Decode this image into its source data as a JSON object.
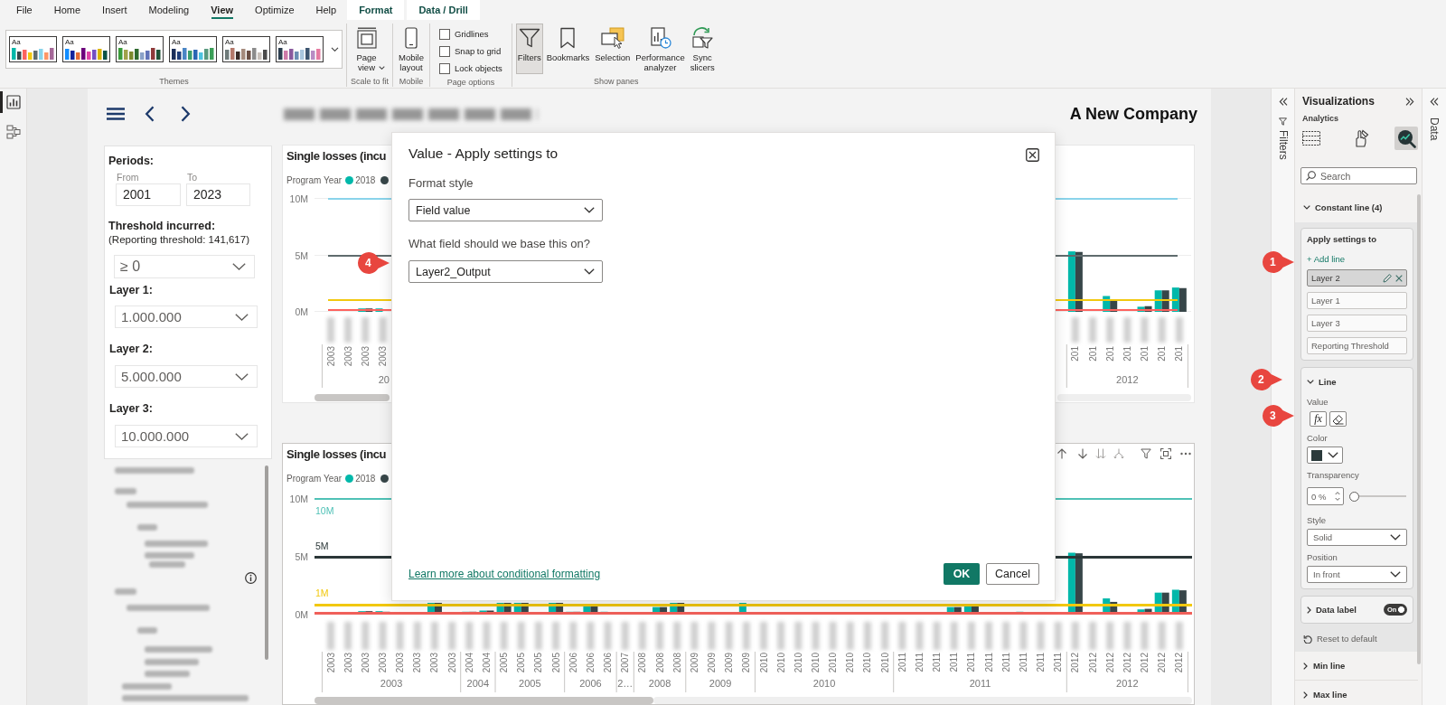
{
  "menu_tabs": [
    {
      "label": "File",
      "kind": "standard",
      "selected": false
    },
    {
      "label": "Home",
      "kind": "standard",
      "selected": false
    },
    {
      "label": "Insert",
      "kind": "standard",
      "selected": false
    },
    {
      "label": "Modeling",
      "kind": "standard",
      "selected": false
    },
    {
      "label": "View",
      "kind": "standard",
      "selected": true
    },
    {
      "label": "Optimize",
      "kind": "standard",
      "selected": false
    },
    {
      "label": "Help",
      "kind": "standard",
      "selected": false
    },
    {
      "label": "Format",
      "kind": "contextual",
      "selected": false
    },
    {
      "label": "Data / Drill",
      "kind": "contextual",
      "selected": false
    }
  ],
  "ribbon": {
    "themes": {
      "swatches": [
        {
          "label": "Aa"
        },
        {
          "label": "Aa"
        },
        {
          "label": "Aa"
        },
        {
          "label": "Aa"
        },
        {
          "label": "Aa"
        },
        {
          "label": "Aa"
        }
      ],
      "group_label": "Themes"
    },
    "scale_to_fit": {
      "button": "Page view",
      "group_label": "Scale to fit"
    },
    "mobile": {
      "button": "Mobile layout",
      "group_label": "Mobile"
    },
    "page_options": {
      "checkboxes": [
        {
          "label": "Gridlines",
          "checked": false
        },
        {
          "label": "Snap to grid",
          "checked": false
        },
        {
          "label": "Lock objects",
          "checked": false
        }
      ],
      "group_label": "Page options"
    },
    "show_panes": {
      "buttons": [
        {
          "label": "Filters",
          "kind": "filters",
          "selected": true
        },
        {
          "label": "Bookmarks",
          "kind": "bookmarks",
          "selected": false
        },
        {
          "label": "Selection",
          "kind": "selection",
          "selected": false
        },
        {
          "label": "Performance analyzer",
          "kind": "performance",
          "selected": false
        },
        {
          "label": "Sync slicers",
          "kind": "sync",
          "selected": false
        }
      ],
      "group_label": "Show panes"
    }
  },
  "nav_rail": [
    {
      "kind": "report",
      "selected": true
    },
    {
      "kind": "model",
      "selected": false
    }
  ],
  "report": {
    "company": "A New Company",
    "filter_panel": {
      "periods_label": "Periods:",
      "from_label": "From",
      "to_label": "To",
      "from_value": "2001",
      "to_value": "2023",
      "threshold_label": "Threshold incurred:",
      "threshold_note": "(Reporting threshold: 141,617)",
      "threshold_value": "≥ 0",
      "layers": [
        {
          "label": "Layer 1:",
          "value": "1.000.000"
        },
        {
          "label": "Layer 2:",
          "value": "5.000.000"
        },
        {
          "label": "Layer 3:",
          "value": "10.000.000"
        }
      ]
    },
    "charts": [
      {
        "title": "Single losses (incu",
        "selected": false,
        "legend_title": "Program Year",
        "legend": [
          {
            "label": "2018",
            "color": "#01b8aa"
          },
          {
            "color": "#374649"
          }
        ],
        "y_ticks": [
          "10M",
          "5M",
          "0M"
        ],
        "constant_lines": [
          {
            "color": "#8ad4eb"
          },
          {
            "color": "#5f6b6d"
          },
          {
            "color": "#f2c80f"
          },
          {
            "color": "#fd625e"
          }
        ],
        "x_groups": [
          {
            "label": "20",
            "ticks": [
              "2003",
              "2003",
              "2003",
              "2003"
            ]
          },
          {
            "label": "2012",
            "ticks": [
              "201",
              "201",
              "201",
              "201",
              "201",
              "201",
              "201"
            ]
          }
        ]
      },
      {
        "title": "Single losses (incu",
        "selected": true,
        "legend_title": "Program Year",
        "legend": [
          {
            "label": "2018",
            "color": "#01b8aa"
          },
          {
            "color": "#374649"
          }
        ],
        "y_ticks": [
          "10M",
          "5M",
          "0M"
        ],
        "constant_lines": [
          {
            "label": "10M",
            "color": "#4fc1b6"
          },
          {
            "label": "5M",
            "color": "#2b3738"
          },
          {
            "label": "1M",
            "color": "#f2c80f"
          },
          {
            "color": "#f0605a"
          }
        ],
        "x_groups": [
          {
            "label": "2003",
            "ticks": [
              "2003",
              "2003",
              "2003",
              "2003",
              "2003",
              "2003",
              "2003",
              "2003"
            ]
          },
          {
            "label": "2004",
            "ticks": [
              "2004",
              "2004"
            ]
          },
          {
            "label": "2005",
            "ticks": [
              "2005",
              "2005",
              "2005",
              "2005"
            ]
          },
          {
            "label": "2006",
            "ticks": [
              "2006",
              "2006",
              "2006"
            ]
          },
          {
            "label": "2…",
            "ticks": [
              "2007"
            ]
          },
          {
            "label": "2008",
            "ticks": [
              "2008",
              "2008",
              "2008"
            ]
          },
          {
            "label": "2009",
            "ticks": [
              "2009",
              "2009",
              "2009",
              "2009"
            ]
          },
          {
            "label": "2010",
            "ticks": [
              "2010",
              "2010",
              "2010",
              "2010",
              "2010",
              "2010",
              "2010",
              "2010"
            ]
          },
          {
            "label": "2011",
            "ticks": [
              "2011",
              "2011",
              "2011",
              "2011",
              "2011",
              "2011",
              "2011",
              "2011",
              "2011",
              "2011"
            ]
          },
          {
            "label": "2012",
            "ticks": [
              "2012",
              "2012",
              "2012",
              "2012",
              "2012",
              "2012",
              "2012"
            ]
          }
        ]
      }
    ]
  },
  "dialog": {
    "title": "Value - Apply settings to",
    "format_style_label": "Format style",
    "format_style_value": "Field value",
    "field_label": "What field should we base this on?",
    "field_value": "Layer2_Output",
    "link": "Learn more about conditional formatting",
    "ok": "OK",
    "cancel": "Cancel"
  },
  "filters_pane": {
    "label": "Filters"
  },
  "visualizations": {
    "title": "Visualizations",
    "tab_caption": "Analytics",
    "tabs": [
      {
        "kind": "build",
        "selected": false
      },
      {
        "kind": "format",
        "selected": false
      },
      {
        "kind": "analytics",
        "selected": true
      }
    ],
    "search": {
      "placeholder": "Search"
    },
    "constant_line": {
      "label": "Constant line (4)",
      "expanded": true,
      "apply_card": {
        "title": "Apply settings to",
        "add_link": "+ Add line",
        "items": [
          {
            "label": "Layer 2",
            "selected": true
          },
          {
            "label": "Layer 1",
            "selected": false
          },
          {
            "label": "Layer 3",
            "selected": false
          },
          {
            "label": "Reporting Threshold",
            "selected": false
          }
        ]
      },
      "line_card": {
        "label": "Line",
        "expanded": true,
        "value_label": "Value",
        "fx_button": "fx",
        "color_picker": {
          "label": "Color",
          "color": "#2b3a3b"
        },
        "transparency": {
          "label": "Transparency",
          "value": "0 %",
          "level": 0
        },
        "style": {
          "label": "Style",
          "value": "Solid"
        },
        "position": {
          "label": "Position",
          "value": "In front"
        }
      },
      "data_label": {
        "label": "Data label",
        "expanded": false,
        "on": true,
        "toggle_text": "On"
      },
      "reset": "Reset to default"
    },
    "collapsed_sections": [
      {
        "label": "Min line",
        "expanded": false
      },
      {
        "label": "Max line",
        "expanded": false
      }
    ]
  },
  "data_pane": {
    "label": "Data"
  },
  "callouts": [
    {
      "label": "1"
    },
    {
      "label": "2"
    },
    {
      "label": "3"
    },
    {
      "label": "4"
    }
  ]
}
